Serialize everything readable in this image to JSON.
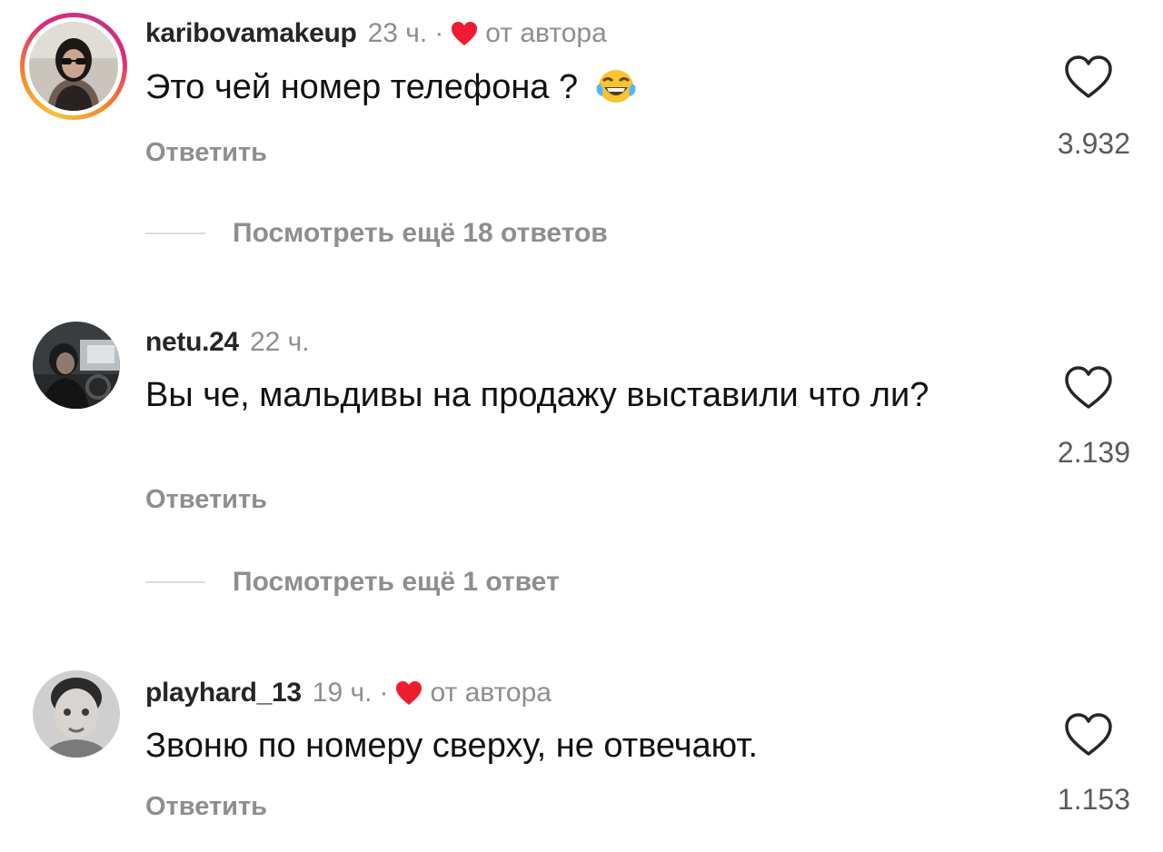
{
  "comments": [
    {
      "username": "karibovamakeup",
      "time": "23 ч.",
      "separator": "·",
      "liked_by_author": true,
      "author_label": "от автора",
      "text": "Это чей номер телефона ?",
      "emoji": "face-with-tears-of-joy",
      "reply_label": "Ответить",
      "like_count": "3.932",
      "view_more": "Посмотреть ещё 18 ответов"
    },
    {
      "username": "netu.24",
      "time": "22 ч.",
      "liked_by_author": false,
      "text": "Вы че, мальдивы на продажу выставили что ли?",
      "reply_label": "Ответить",
      "like_count": "2.139",
      "view_more": "Посмотреть ещё 1 ответ"
    },
    {
      "username": "playhard_13",
      "time": "19 ч.",
      "separator": "·",
      "liked_by_author": true,
      "author_label": "от автора",
      "text": "Звоню по номеру сверху, не отвечают.",
      "reply_label": "Ответить",
      "like_count": "1.153"
    }
  ],
  "colors": {
    "author_heart": "#ed1c2e",
    "muted_text": "#8e8e8e",
    "story_ring": [
      "#f9c33a",
      "#dd2a7b"
    ]
  },
  "icons": {
    "like": "heart-outline-icon",
    "author_like": "heart-filled-icon"
  }
}
